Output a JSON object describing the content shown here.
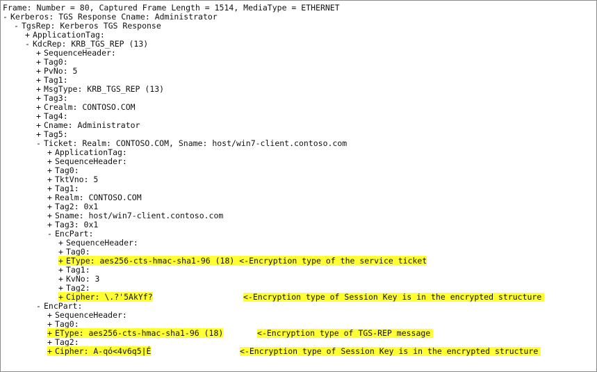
{
  "colors": {
    "highlight": "#ffff33",
    "text": "#111111",
    "background": "#ffffff",
    "border": "#8a8a8a"
  },
  "tree": [
    {
      "level": 0,
      "expander": "",
      "text": "Frame: Number = 80, Captured Frame Length = 1514, MediaType = ETHERNET"
    },
    {
      "level": 0,
      "expander": "-",
      "text": "Kerberos: TGS Response Cname: Administrator"
    },
    {
      "level": 1,
      "expander": "-",
      "text": "TgsRep: Kerberos TGS Response"
    },
    {
      "level": 2,
      "expander": "+",
      "text": "ApplicationTag:"
    },
    {
      "level": 2,
      "expander": "-",
      "text": "KdcRep: KRB_TGS_REP (13)"
    },
    {
      "level": 3,
      "expander": "+",
      "text": "SequenceHeader:"
    },
    {
      "level": 3,
      "expander": "+",
      "text": "Tag0:"
    },
    {
      "level": 3,
      "expander": "+",
      "text": "PvNo: 5"
    },
    {
      "level": 3,
      "expander": "+",
      "text": "Tag1:"
    },
    {
      "level": 3,
      "expander": "+",
      "text": "MsgType: KRB_TGS_REP (13)"
    },
    {
      "level": 3,
      "expander": "+",
      "text": "Tag3:"
    },
    {
      "level": 3,
      "expander": "+",
      "text": "Crealm: CONTOSO.COM"
    },
    {
      "level": 3,
      "expander": "+",
      "text": "Tag4:"
    },
    {
      "level": 3,
      "expander": "+",
      "text": "Cname: Administrator"
    },
    {
      "level": 3,
      "expander": "+",
      "text": "Tag5:"
    },
    {
      "level": 3,
      "expander": "-",
      "text": "Ticket: Realm: CONTOSO.COM, Sname: host/win7-client.contoso.com"
    },
    {
      "level": 4,
      "expander": "+",
      "text": "ApplicationTag:"
    },
    {
      "level": 4,
      "expander": "+",
      "text": "SequenceHeader:"
    },
    {
      "level": 4,
      "expander": "+",
      "text": "Tag0:"
    },
    {
      "level": 4,
      "expander": "+",
      "text": "TktVno: 5"
    },
    {
      "level": 4,
      "expander": "+",
      "text": "Tag1:"
    },
    {
      "level": 4,
      "expander": "+",
      "text": "Realm: CONTOSO.COM"
    },
    {
      "level": 4,
      "expander": "+",
      "text": "Tag2: 0x1"
    },
    {
      "level": 4,
      "expander": "+",
      "text": "Sname: host/win7-client.contoso.com"
    },
    {
      "level": 4,
      "expander": "+",
      "text": "Tag3: 0x1"
    },
    {
      "level": 4,
      "expander": "-",
      "text": "EncPart:"
    },
    {
      "level": 5,
      "expander": "+",
      "text": "SequenceHeader:"
    },
    {
      "level": 5,
      "expander": "+",
      "text": "Tag0:"
    },
    {
      "level": 5,
      "expander": "+",
      "text": "EType: aes256-cts-hmac-sha1-96 (18) <-Encryption type of the service ticket",
      "highlight": true
    },
    {
      "level": 5,
      "expander": "+",
      "text": "Tag1:"
    },
    {
      "level": 5,
      "expander": "+",
      "text": "KvNo: 3"
    },
    {
      "level": 5,
      "expander": "+",
      "text": "Tag2:"
    },
    {
      "level": 5,
      "expander": "+",
      "text": "Cipher: \\.?'5AkYf?",
      "highlight": true,
      "note": "<-Encryption type of Session Key is in the encrypted structure",
      "note_col": 346
    },
    {
      "level": 3,
      "expander": "-",
      "text": "EncPart:"
    },
    {
      "level": 4,
      "expander": "+",
      "text": "SequenceHeader:"
    },
    {
      "level": 4,
      "expander": "+",
      "text": "Tag0:"
    },
    {
      "level": 4,
      "expander": "+",
      "text": "EType: aes256-cts-hmac-sha1-96 (18)",
      "highlight": true,
      "note": "<-Encryption type  of TGS-REP message",
      "note_col": 366
    },
    {
      "level": 4,
      "expander": "+",
      "text": "Tag2:"
    },
    {
      "level": 4,
      "expander": "+",
      "text": "Cipher: A-qó<4v6q5|É",
      "highlight": true,
      "note": "<-Encryption type of Session Key is in the encrypted structure",
      "note_col": 341
    }
  ]
}
